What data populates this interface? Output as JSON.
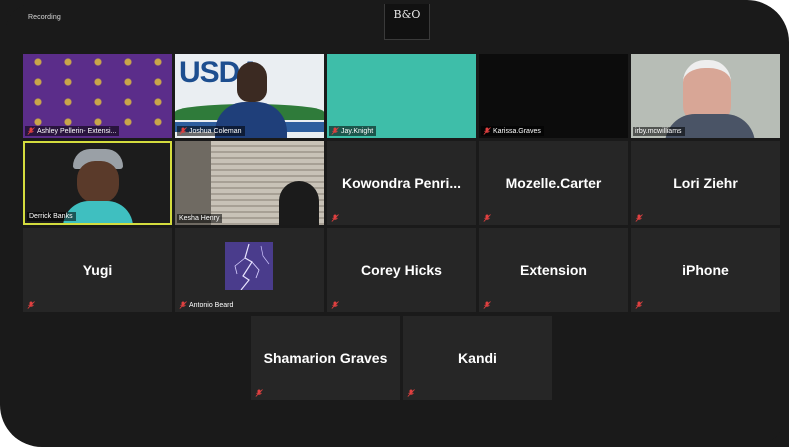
{
  "recording_label": "Recording",
  "logo_text": "B&O",
  "participants": [
    {
      "name": "Ashley Pellerin- Extensi...",
      "kind": "video",
      "video": "purple-backdrop",
      "muted": true
    },
    {
      "name": "Joshua Coleman",
      "kind": "video",
      "video": "usda-backdrop",
      "muted": true
    },
    {
      "name": "Jay.Knight",
      "kind": "video",
      "video": "teal",
      "muted": true
    },
    {
      "name": "Karissa.Graves",
      "kind": "video",
      "video": "black",
      "muted": true
    },
    {
      "name": "irby.mcwilliams",
      "kind": "video",
      "video": "older-man",
      "muted": false
    },
    {
      "name": "Derrick Banks",
      "kind": "video",
      "video": "man-cap",
      "muted": false,
      "active_speaker": true
    },
    {
      "name": "Kesha Henry",
      "kind": "video",
      "video": "blinds",
      "muted": false
    },
    {
      "name": "Kowondra  Penri...",
      "kind": "name",
      "muted": true
    },
    {
      "name": "Mozelle.Carter",
      "kind": "name",
      "muted": true
    },
    {
      "name": "Lori Ziehr",
      "kind": "name",
      "muted": true
    },
    {
      "name": "Yugi",
      "kind": "name",
      "muted": true
    },
    {
      "name": "Antonio Beard",
      "kind": "image",
      "video": "lightning",
      "muted": true
    },
    {
      "name": "Corey Hicks",
      "kind": "name",
      "muted": true
    },
    {
      "name": "Extension",
      "kind": "name",
      "muted": true
    },
    {
      "name": "iPhone",
      "kind": "name",
      "muted": true
    },
    {
      "name": "Shamarion Graves",
      "kind": "name",
      "muted": true
    },
    {
      "name": "Kandi",
      "kind": "name",
      "muted": true
    }
  ],
  "colors": {
    "background": "#1a1a1a",
    "tile": "#262626",
    "active_border": "#d4dc3e",
    "mute_icon": "#e04040"
  }
}
